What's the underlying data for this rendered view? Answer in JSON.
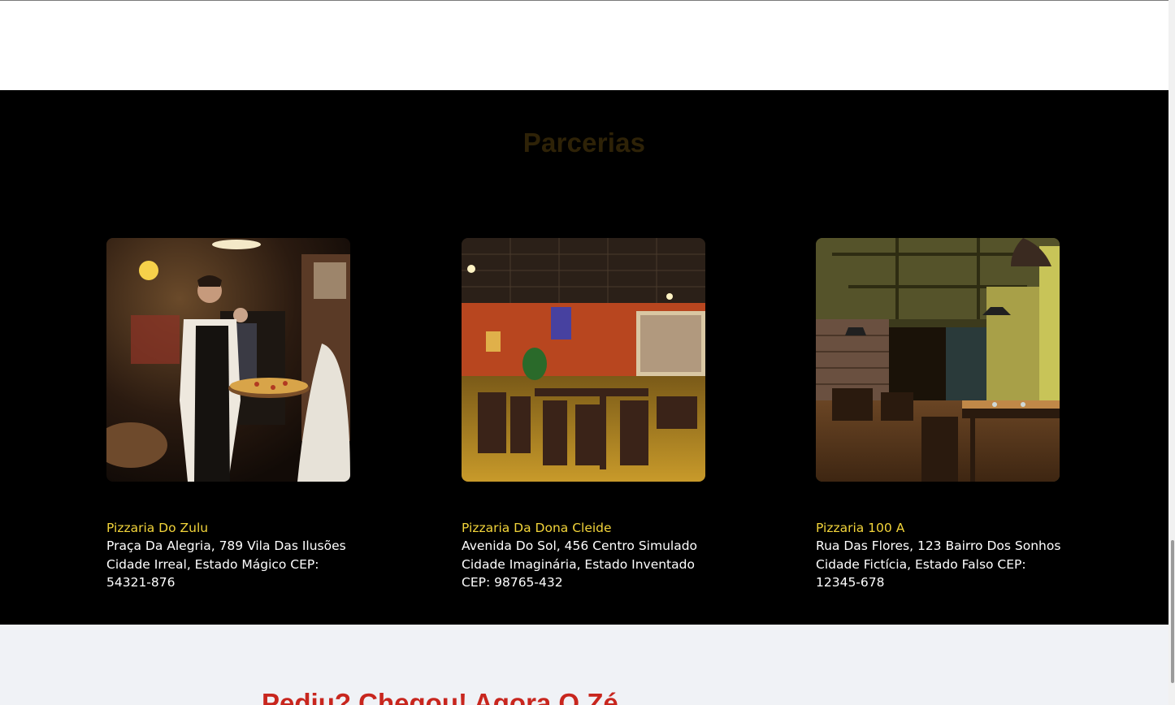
{
  "section": {
    "title": "Parcerias",
    "partners": [
      {
        "name": "Pizzaria Do Zulu",
        "address": "Praça Da Alegria, 789 Vila Das Ilusões Cidade Irreal, Estado Mágico CEP: 54321-876"
      },
      {
        "name": "Pizzaria Da Dona Cleide",
        "address": "Avenida Do Sol, 456 Centro Simulado Cidade Imaginária, Estado Inventado CEP: 98765-432"
      },
      {
        "name": "Pizzaria 100 A",
        "address": "Rua Das Flores, 123 Bairro Dos Sonhos Cidade Fictícia, Estado Falso CEP: 12345-678"
      }
    ]
  },
  "next_section": {
    "title": "Pediu? Chegou! Agora O Zé"
  },
  "colors": {
    "section_background": "#000000",
    "title": "#2e2207",
    "partner_name": "#f2d43a",
    "next_title": "#c8261e"
  }
}
